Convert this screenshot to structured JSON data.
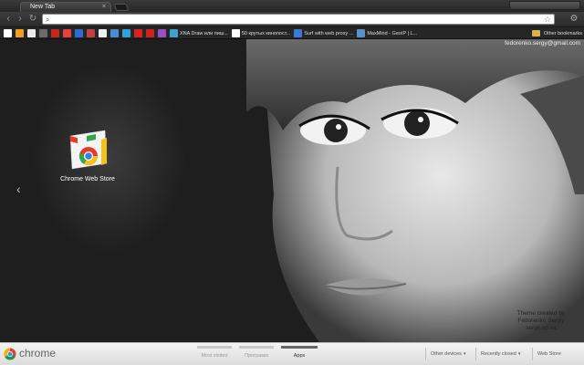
{
  "tab": {
    "title": "New Tab",
    "close": "×"
  },
  "toolbar": {
    "back": "‹",
    "forward": "›",
    "reload": "↻",
    "address_value": "",
    "star": "☆",
    "wrench": "⚙"
  },
  "bookmarks": {
    "items": [
      {
        "label": "",
        "color": "#ffffff"
      },
      {
        "label": "",
        "color": "#f0a020"
      },
      {
        "label": "",
        "color": "#e8e8e8"
      },
      {
        "label": "",
        "color": "#6a6a6a"
      },
      {
        "label": "",
        "color": "#cc2222"
      },
      {
        "label": "",
        "color": "#e84040"
      },
      {
        "label": "",
        "color": "#2a6cd0"
      },
      {
        "label": "",
        "color": "#c04040"
      },
      {
        "label": "",
        "color": "#eeeeee"
      },
      {
        "label": "",
        "color": "#4a8bd8"
      },
      {
        "label": "",
        "color": "#30a0e0"
      },
      {
        "label": "",
        "color": "#e02020"
      },
      {
        "label": "",
        "color": "#d02020"
      },
      {
        "label": "",
        "color": "#9a50c0"
      },
      {
        "label": "XNA Draw или пиш...",
        "color": "#40a0d0"
      },
      {
        "label": "50 крутых кинопост...",
        "color": "#ffffff"
      },
      {
        "label": "Surf with web proxy ...",
        "color": "#3a7ad8"
      },
      {
        "label": "MaxMind - GeoIP | L...",
        "color": "#5a90c8"
      }
    ],
    "other": "Other bookmarks"
  },
  "content": {
    "email": "fedorenko.sergy@gmail.com",
    "app_label": "Chrome Web Store",
    "arrow": "‹",
    "credit_line1": "Theme created by",
    "credit_line2": "Fedorenko Sergiy",
    "credit_line3": "sergij.pp.ua"
  },
  "footer": {
    "brand": "chrome",
    "sections": [
      "Most visited",
      "Программ",
      "Apps"
    ],
    "active_section": "Apps",
    "other_devices": "Other devices",
    "recently_closed": "Recently closed",
    "web_store": "Web Store",
    "caret": "▾"
  }
}
